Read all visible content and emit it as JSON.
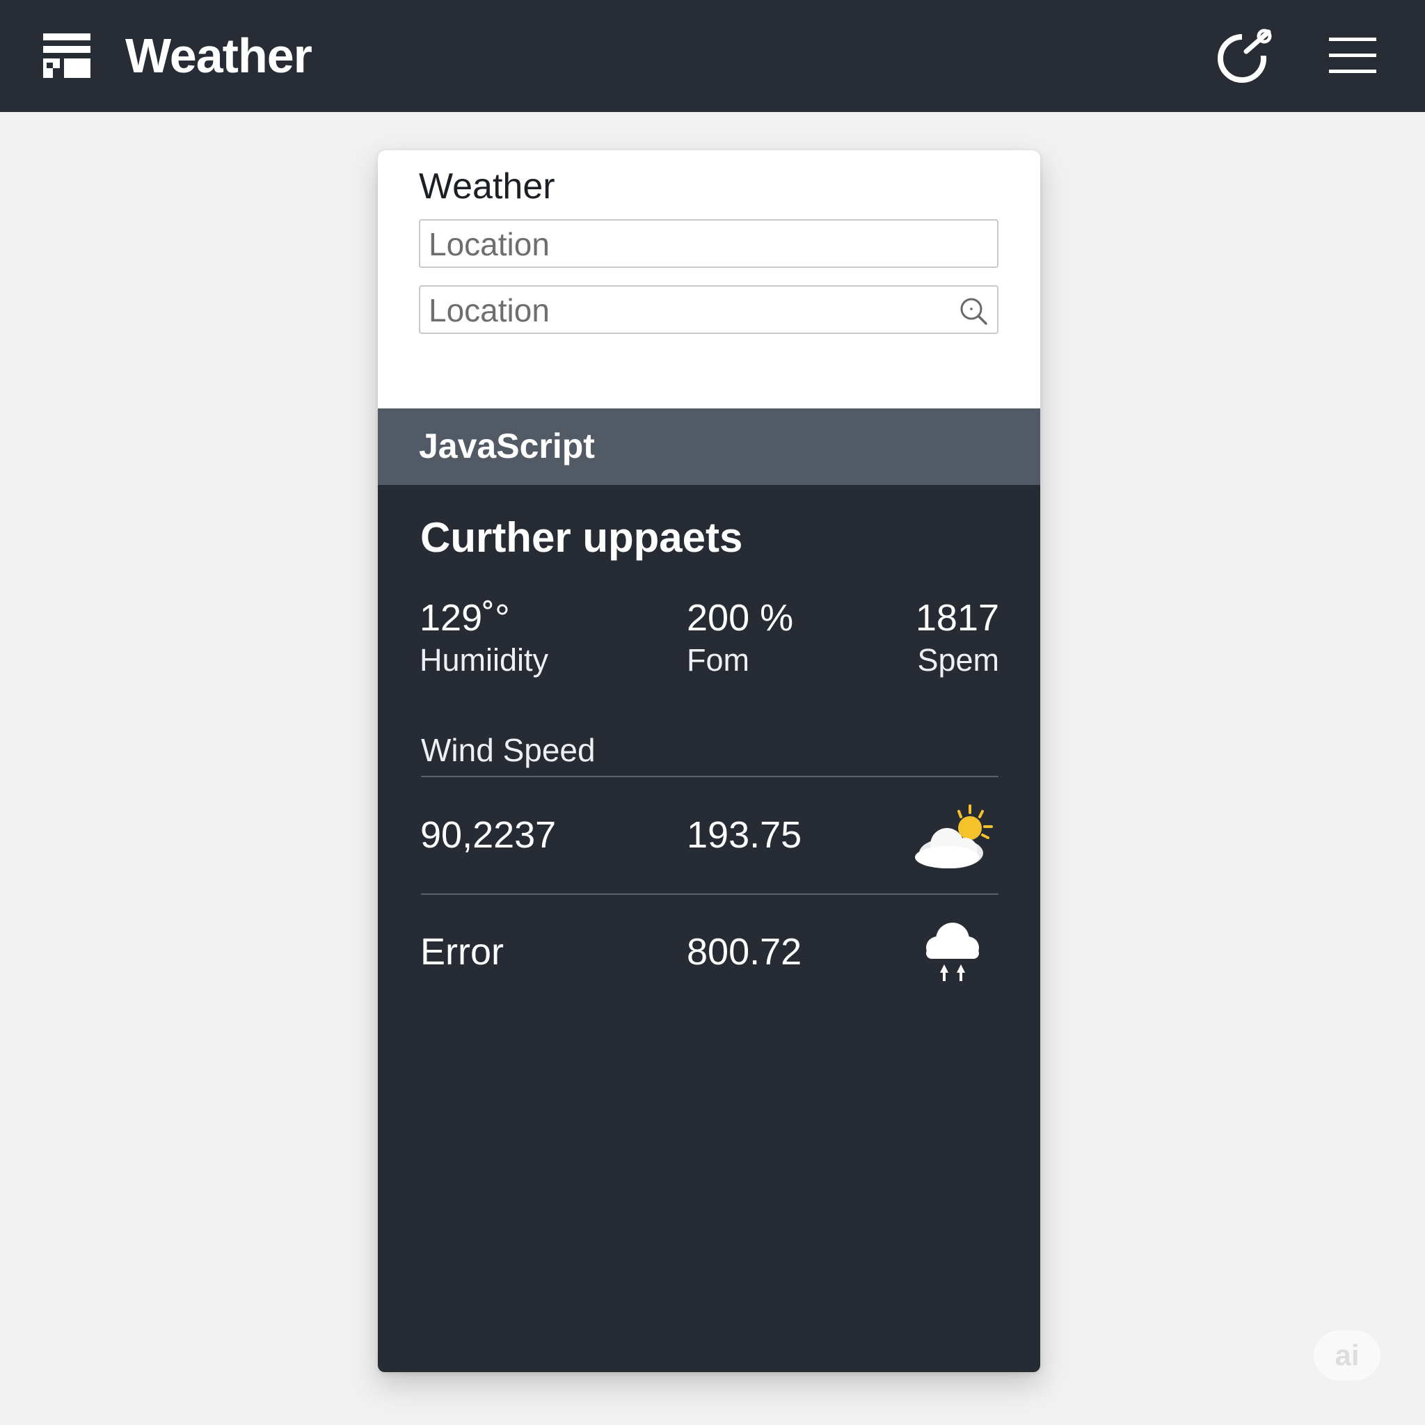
{
  "header": {
    "title": "Weather",
    "app_icon": "grid-layout-icon",
    "refresh_icon": "refresh-icon",
    "menu_icon": "hamburger-menu-icon"
  },
  "card": {
    "heading": "Weather",
    "location_input_1": {
      "placeholder": "Location",
      "value": ""
    },
    "location_input_2": {
      "placeholder": "Location",
      "value": "",
      "icon": "search-icon"
    },
    "section_label": "JavaScript",
    "updates_title": "Curther uppaets",
    "stats": [
      {
        "value": "129˚°",
        "label": "Humiidity"
      },
      {
        "value": "200 %",
        "label": "Fom"
      },
      {
        "value": "1817",
        "label": "Spem"
      }
    ],
    "wind_label": "Wind Speed",
    "rows": [
      {
        "col1": "90,2237",
        "col2": "193.75",
        "icon": "partly-cloudy-icon"
      },
      {
        "col1": "Error",
        "col2": "800.72",
        "icon": "rain-cloud-icon"
      }
    ]
  },
  "colors": {
    "topbar": "#282c35",
    "card_dark": "#272b34",
    "section_band": "#525a65",
    "sun": "#f5c22b",
    "background": "#f1f1f1"
  },
  "watermark": "ai"
}
